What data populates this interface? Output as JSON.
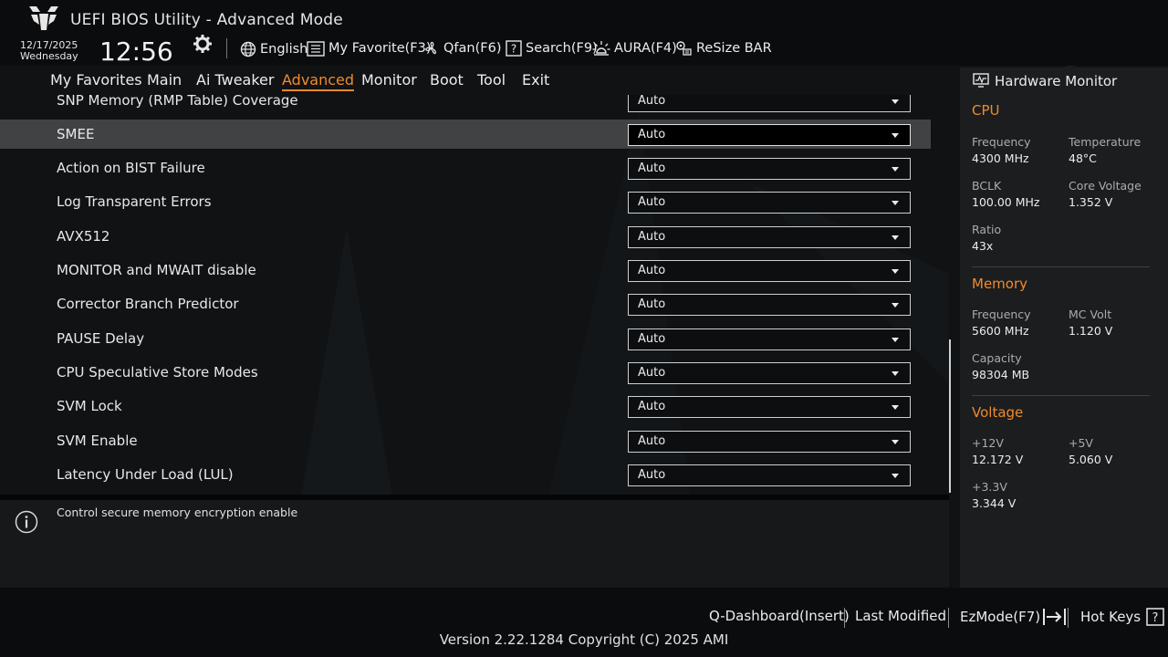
{
  "header": {
    "title": "UEFI BIOS Utility - Advanced Mode",
    "date": "12/17/2025",
    "weekday": "Wednesday",
    "time": "12:56",
    "toolbar": {
      "language": "English",
      "favorite": "My Favorite(F3)",
      "qfan": "Qfan(F6)",
      "search": "Search(F9)",
      "aura": "AURA(F4)",
      "resize_bar": "ReSize BAR"
    }
  },
  "menu": [
    {
      "label": "My Favorites"
    },
    {
      "label": "Main"
    },
    {
      "label": "Ai Tweaker"
    },
    {
      "label": "Advanced",
      "active": true
    },
    {
      "label": "Monitor"
    },
    {
      "label": "Boot"
    },
    {
      "label": "Tool"
    },
    {
      "label": "Exit"
    }
  ],
  "settings": [
    {
      "label": "SNP Memory (RMP Table) Coverage",
      "value": "Auto"
    },
    {
      "label": "SMEE",
      "value": "Auto",
      "selected": true
    },
    {
      "label": "Action on BIST Failure",
      "value": "Auto"
    },
    {
      "label": "Log Transparent Errors",
      "value": "Auto"
    },
    {
      "label": "AVX512",
      "value": "Auto"
    },
    {
      "label": "MONITOR and MWAIT disable",
      "value": "Auto"
    },
    {
      "label": "Corrector Branch Predictor",
      "value": "Auto"
    },
    {
      "label": "PAUSE Delay",
      "value": "Auto"
    },
    {
      "label": "CPU Speculative Store Modes",
      "value": "Auto"
    },
    {
      "label": "SVM Lock",
      "value": "Auto"
    },
    {
      "label": "SVM Enable",
      "value": "Auto"
    },
    {
      "label": "Latency Under Load (LUL)",
      "value": "Auto"
    }
  ],
  "help": {
    "text": "Control secure memory encryption enable"
  },
  "hardware_monitor": {
    "title": "Hardware Monitor",
    "cpu": {
      "heading": "CPU",
      "frequency_label": "Frequency",
      "frequency": "4300 MHz",
      "temperature_label": "Temperature",
      "temperature": "48°C",
      "bclk_label": "BCLK",
      "bclk": "100.00 MHz",
      "core_voltage_label": "Core Voltage",
      "core_voltage": "1.352 V",
      "ratio_label": "Ratio",
      "ratio": "43x"
    },
    "memory": {
      "heading": "Memory",
      "frequency_label": "Frequency",
      "frequency": "5600 MHz",
      "mc_volt_label": "MC Volt",
      "mc_volt": "1.120 V",
      "capacity_label": "Capacity",
      "capacity": "98304 MB"
    },
    "voltage": {
      "heading": "Voltage",
      "v12_label": "+12V",
      "v12": "12.172 V",
      "v5_label": "+5V",
      "v5": "5.060 V",
      "v33_label": "+3.3V",
      "v33": "3.344 V"
    }
  },
  "footer": {
    "q_dashboard": "Q-Dashboard(Insert)",
    "last_modified": "Last Modified",
    "ez_mode": "EzMode(F7)",
    "hot_keys": "Hot Keys",
    "version": "Version 2.22.1284 Copyright (C) 2025 AMI"
  },
  "colors": {
    "accent": "#f08a2c",
    "background": "#101214",
    "selected_row": "#404244",
    "panel": "#1b1d1f"
  }
}
